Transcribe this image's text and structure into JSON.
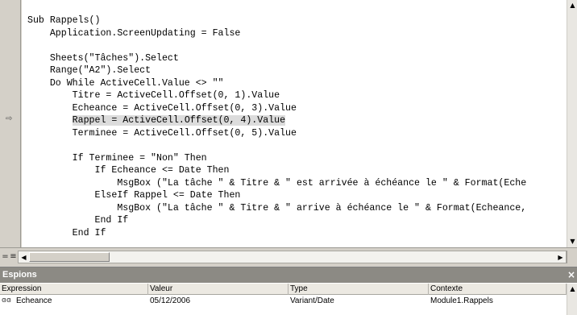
{
  "code_window": {
    "lines": [
      "Sub Rappels()",
      "    Application.ScreenUpdating = False",
      "",
      "    Sheets(\"Tâches\").Select",
      "    Range(\"A2\").Select",
      "    Do While ActiveCell.Value <> \"\"",
      "        Titre = ActiveCell.Offset(0, 1).Value",
      "        Echeance = ActiveCell.Offset(0, 3).Value",
      "        Rappel = ActiveCell.Offset(0, 4).Value",
      "        Terminee = ActiveCell.Offset(0, 5).Value",
      "",
      "        If Terminee = \"Non\" Then",
      "            If Echeance <= Date Then",
      "                MsgBox (\"La tâche \" & Titre & \" est arrivée à échéance le \" & Format(Eche",
      "            ElseIf Rappel <= Date Then",
      "                MsgBox (\"La tâche \" & Titre & \" arrive à échéance le \" & Format(Echeance,",
      "            End If",
      "        End If"
    ],
    "highlight_line_index": 8,
    "execution_arrow": "⇨",
    "view_buttons": [
      "=",
      "≡"
    ]
  },
  "watch_window": {
    "title": "Espions",
    "close_glyph": "×",
    "columns": [
      "Expression",
      "Valeur",
      "Type",
      "Contexte"
    ],
    "rows": [
      {
        "icon": "watch-glasses-icon",
        "expression": "Echeance",
        "value": "05/12/2006",
        "type": "Variant/Date",
        "context": "Module1.Rappels"
      }
    ]
  },
  "scrollbar_glyphs": {
    "up": "▲",
    "down": "▼",
    "left": "◀",
    "right": "▶"
  }
}
